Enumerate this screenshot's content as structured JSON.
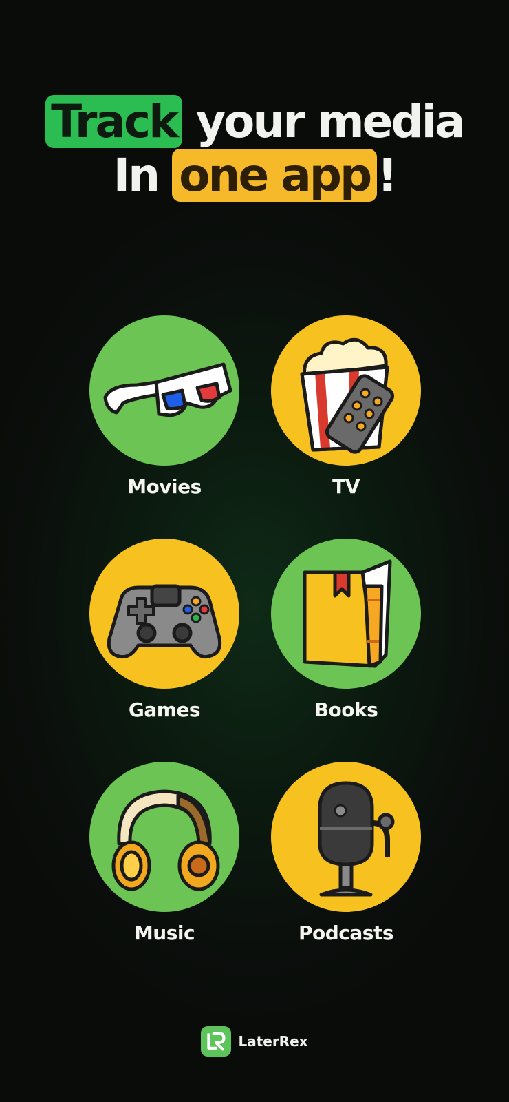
{
  "headline": {
    "line1_highlight": "Track",
    "line1_rest": " your media",
    "line2_start": "In ",
    "line2_highlight": "one app",
    "line2_end": "!"
  },
  "categories": [
    {
      "label": "Movies",
      "icon": "3d-glasses-icon",
      "color": "#6cc455"
    },
    {
      "label": "TV",
      "icon": "popcorn-remote-icon",
      "color": "#f7c21f"
    },
    {
      "label": "Games",
      "icon": "gamepad-icon",
      "color": "#f7c21f"
    },
    {
      "label": "Books",
      "icon": "book-icon",
      "color": "#6cc455"
    },
    {
      "label": "Music",
      "icon": "headphones-icon",
      "color": "#6cc455"
    },
    {
      "label": "Podcasts",
      "icon": "microphone-icon",
      "color": "#f7c21f"
    }
  ],
  "brand": {
    "name": "LaterRex",
    "logo": "LR"
  },
  "colors": {
    "green": "#2bbd52",
    "yellow": "#f5b92a",
    "background": "#0b0f0c"
  }
}
